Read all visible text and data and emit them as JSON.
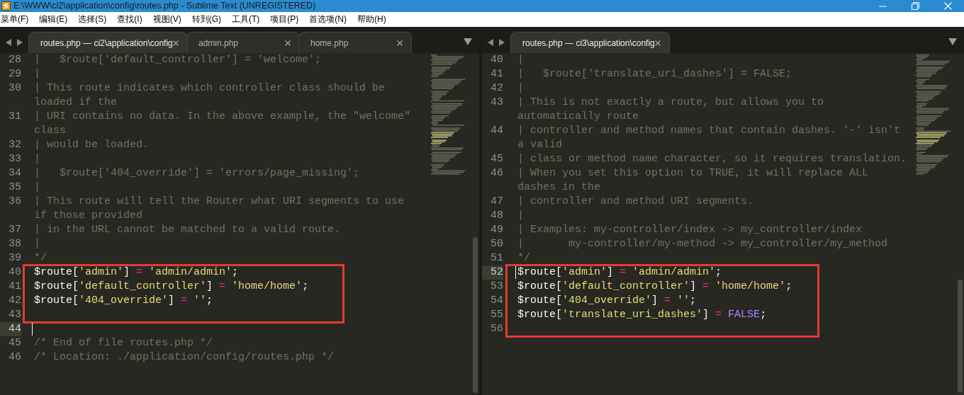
{
  "window": {
    "title": "E:\\WWW\\ci2\\application\\config\\routes.php - Sublime Text (UNREGISTERED)"
  },
  "menu": [
    "菜单(F)",
    "编辑(E)",
    "选择(S)",
    "查找(I)",
    "视图(V)",
    "转到(G)",
    "工具(T)",
    "项目(P)",
    "首选项(N)",
    "帮助(H)"
  ],
  "panes": [
    {
      "tabs": [
        {
          "label": "routes.php — ci2\\application\\config",
          "selected": true
        },
        {
          "label": "admin.php",
          "selected": false
        },
        {
          "label": "home.php",
          "selected": false
        }
      ],
      "lines": [
        {
          "number": "28",
          "kind": "comment",
          "text": "|   $route['default_controller'] = 'welcome';",
          "current": false,
          "boxed": false
        },
        {
          "number": "29",
          "kind": "comment",
          "text": "|",
          "current": false,
          "boxed": false
        },
        {
          "number": "30",
          "kind": "comment",
          "text": "| This route indicates which controller class should be loaded if the",
          "current": false,
          "boxed": false
        },
        {
          "number": "31",
          "kind": "comment",
          "text": "| URI contains no data. In the above example, the \"welcome\" class",
          "current": false,
          "boxed": false
        },
        {
          "number": "32",
          "kind": "comment",
          "text": "| would be loaded.",
          "current": false,
          "boxed": false
        },
        {
          "number": "33",
          "kind": "comment",
          "text": "|",
          "current": false,
          "boxed": false
        },
        {
          "number": "34",
          "kind": "comment",
          "text": "|   $route['404_override'] = 'errors/page_missing';",
          "current": false,
          "boxed": false
        },
        {
          "number": "35",
          "kind": "comment",
          "text": "|",
          "current": false,
          "boxed": false
        },
        {
          "number": "36",
          "kind": "comment",
          "text": "| This route will tell the Router what URI segments to use if those provided",
          "current": false,
          "boxed": false
        },
        {
          "number": "37",
          "kind": "comment",
          "text": "| in the URL cannot be matched to a valid route.",
          "current": false,
          "boxed": false
        },
        {
          "number": "38",
          "kind": "comment",
          "text": "|",
          "current": false,
          "boxed": false
        },
        {
          "number": "39",
          "kind": "comment",
          "text": "*/",
          "current": false,
          "boxed": false
        },
        {
          "number": "40",
          "kind": "code",
          "tokens": [
            {
              "kind": "var",
              "text": "$route"
            },
            {
              "kind": "punct",
              "text": "["
            },
            {
              "kind": "str",
              "text": "'admin'"
            },
            {
              "kind": "punct",
              "text": "] "
            },
            {
              "kind": "op",
              "text": "="
            },
            {
              "kind": "str",
              "text": " 'admin/admin'"
            },
            {
              "kind": "punct",
              "text": ";"
            }
          ],
          "current": false,
          "boxed": true
        },
        {
          "number": "41",
          "kind": "code",
          "tokens": [
            {
              "kind": "var",
              "text": "$route"
            },
            {
              "kind": "punct",
              "text": "["
            },
            {
              "kind": "str",
              "text": "'default_controller'"
            },
            {
              "kind": "punct",
              "text": "] "
            },
            {
              "kind": "op",
              "text": "="
            },
            {
              "kind": "str",
              "text": " 'home/home'"
            },
            {
              "kind": "punct",
              "text": ";"
            }
          ],
          "current": false,
          "boxed": true
        },
        {
          "number": "42",
          "kind": "code",
          "tokens": [
            {
              "kind": "var",
              "text": "$route"
            },
            {
              "kind": "punct",
              "text": "["
            },
            {
              "kind": "str",
              "text": "'404_override'"
            },
            {
              "kind": "punct",
              "text": "] "
            },
            {
              "kind": "op",
              "text": "="
            },
            {
              "kind": "str",
              "text": " ''"
            },
            {
              "kind": "punct",
              "text": ";"
            }
          ],
          "current": false,
          "boxed": true
        },
        {
          "number": "43",
          "kind": "blank",
          "current": false,
          "boxed": true
        },
        {
          "number": "44",
          "kind": "blank",
          "current": true,
          "boxed": false
        },
        {
          "number": "45",
          "kind": "comment",
          "text": "/* End of file routes.php */",
          "current": false,
          "boxed": false
        },
        {
          "number": "46",
          "kind": "comment",
          "text": "/* Location: ./application/config/routes.php */",
          "current": false,
          "boxed": false
        }
      ]
    },
    {
      "tabs": [
        {
          "label": "routes.php — ci3\\application\\config",
          "selected": true
        }
      ],
      "lines": [
        {
          "number": "40",
          "kind": "comment",
          "text": "|",
          "current": false,
          "boxed": false
        },
        {
          "number": "41",
          "kind": "comment",
          "text": "|   $route['translate_uri_dashes'] = FALSE;",
          "current": false,
          "boxed": false
        },
        {
          "number": "42",
          "kind": "comment",
          "text": "|",
          "current": false,
          "boxed": false
        },
        {
          "number": "43",
          "kind": "comment",
          "text": "| This is not exactly a route, but allows you to automatically route",
          "current": false,
          "boxed": false
        },
        {
          "number": "44",
          "kind": "comment",
          "text": "| controller and method names that contain dashes. '-' isn't a valid",
          "current": false,
          "boxed": false
        },
        {
          "number": "45",
          "kind": "comment",
          "text": "| class or method name character, so it requires translation.",
          "current": false,
          "boxed": false
        },
        {
          "number": "46",
          "kind": "comment",
          "text": "| When you set this option to TRUE, it will replace ALL dashes in the",
          "current": false,
          "boxed": false
        },
        {
          "number": "47",
          "kind": "comment",
          "text": "| controller and method URI segments.",
          "current": false,
          "boxed": false
        },
        {
          "number": "48",
          "kind": "comment",
          "text": "|",
          "current": false,
          "boxed": false
        },
        {
          "number": "49",
          "kind": "comment",
          "text": "| Examples: my-controller/index -> my_controller/index",
          "current": false,
          "boxed": false
        },
        {
          "number": "50",
          "kind": "comment",
          "text": "|       my-controller/my-method -> my_controller/my_method",
          "current": false,
          "boxed": false
        },
        {
          "number": "51",
          "kind": "comment",
          "text": "*/",
          "current": false,
          "boxed": false
        },
        {
          "number": "52",
          "kind": "code",
          "tokens": [
            {
              "kind": "var",
              "text": "$route"
            },
            {
              "kind": "punct",
              "text": "["
            },
            {
              "kind": "str",
              "text": "'admin'"
            },
            {
              "kind": "punct",
              "text": "] "
            },
            {
              "kind": "op",
              "text": "="
            },
            {
              "kind": "str",
              "text": " 'admin/admin'"
            },
            {
              "kind": "punct",
              "text": ";"
            }
          ],
          "current": true,
          "boxed": true
        },
        {
          "number": "53",
          "kind": "code",
          "tokens": [
            {
              "kind": "var",
              "text": "$route"
            },
            {
              "kind": "punct",
              "text": "["
            },
            {
              "kind": "str",
              "text": "'default_controller'"
            },
            {
              "kind": "punct",
              "text": "] "
            },
            {
              "kind": "op",
              "text": "="
            },
            {
              "kind": "str",
              "text": " 'home/home'"
            },
            {
              "kind": "punct",
              "text": ";"
            }
          ],
          "current": false,
          "boxed": true
        },
        {
          "number": "54",
          "kind": "code",
          "tokens": [
            {
              "kind": "var",
              "text": "$route"
            },
            {
              "kind": "punct",
              "text": "["
            },
            {
              "kind": "str",
              "text": "'404_override'"
            },
            {
              "kind": "punct",
              "text": "] "
            },
            {
              "kind": "op",
              "text": "="
            },
            {
              "kind": "str",
              "text": " ''"
            },
            {
              "kind": "punct",
              "text": ";"
            }
          ],
          "current": false,
          "boxed": true
        },
        {
          "number": "55",
          "kind": "code",
          "tokens": [
            {
              "kind": "var",
              "text": "$route"
            },
            {
              "kind": "punct",
              "text": "["
            },
            {
              "kind": "str",
              "text": "'translate_uri_dashes'"
            },
            {
              "kind": "punct",
              "text": "] "
            },
            {
              "kind": "op",
              "text": "="
            },
            {
              "kind": "const",
              "text": " FALSE"
            },
            {
              "kind": "punct",
              "text": ";"
            }
          ],
          "current": false,
          "boxed": true
        },
        {
          "number": "56",
          "kind": "blank",
          "current": false,
          "boxed": true
        }
      ]
    }
  ]
}
